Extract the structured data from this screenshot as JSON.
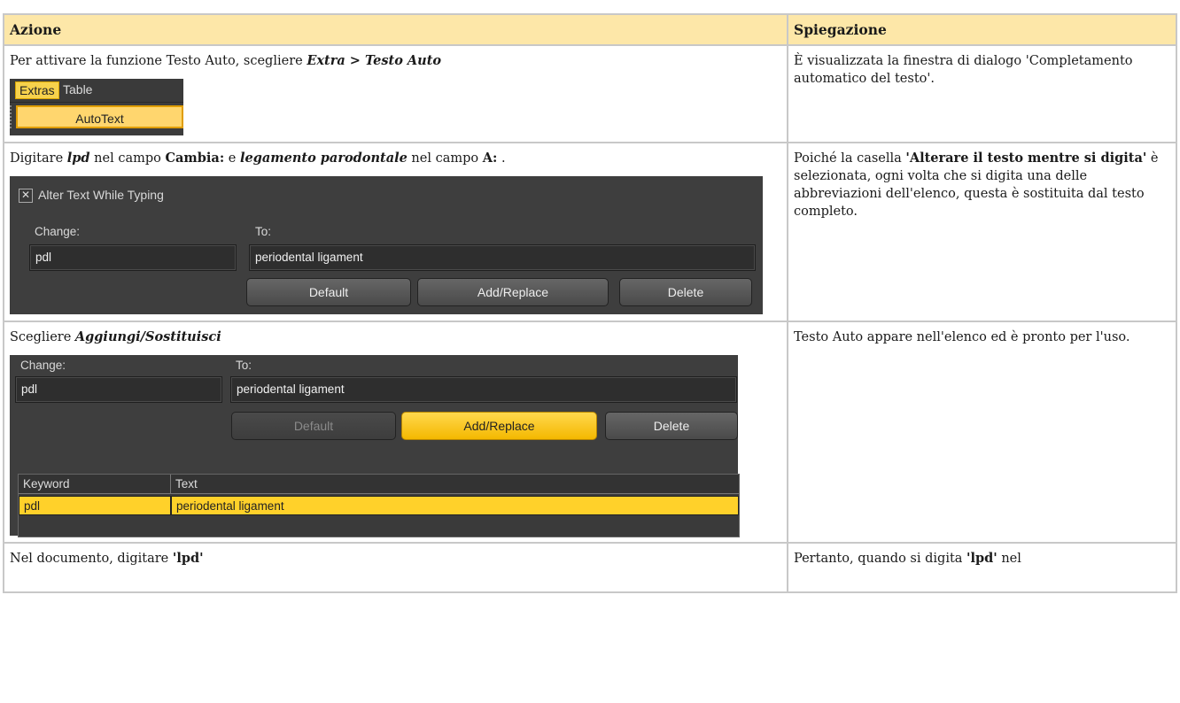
{
  "table": {
    "header_col1": "Azione",
    "header_col2": "Spiegazione"
  },
  "row1": {
    "text_pre": "Per attivare la funzione Testo Auto, scegliere ",
    "text_menu": "Extra > Testo Auto",
    "explain": "È visualizzata la finestra di dialogo 'Completamento automatico del testo'.",
    "menu": {
      "extras": "Extras",
      "table": "Table",
      "item": "AutoText"
    }
  },
  "row2": {
    "p1": "Digitare ",
    "p2": "lpd",
    "p3": " nel campo ",
    "p4": "Cambia:",
    "p5": " e ",
    "p6": "legamento parodontale",
    "p7": " nel campo ",
    "p8": "A:",
    "p9": " .",
    "explain_pre": "Poiché la casella ",
    "explain_bold": "'Alterare il testo mentre si digita'",
    "explain_post": " è selezionata, ogni volta che si digita una delle abbreviazioni dell'elenco, questa è sostituita dal testo completo.",
    "dialog": {
      "checkbox_label": "Alter Text While Typing",
      "checkbox_mark": "✕",
      "change_label": "Change:",
      "to_label": "To:",
      "change_value": "pdl",
      "to_value": "periodental ligament",
      "btn_default": "Default",
      "btn_add": "Add/Replace",
      "btn_delete": "Delete"
    }
  },
  "row3": {
    "text_pre": "Scegliere ",
    "text_bold": "Aggiungi/Sostituisci",
    "explain": "Testo Auto appare nell'elenco ed è pronto per l'uso.",
    "dialog": {
      "change_label": "Change:",
      "to_label": "To:",
      "change_value": "pdl",
      "to_value": "periodental ligament",
      "btn_default": "Default",
      "btn_add": "Add/Replace",
      "btn_delete": "Delete",
      "col_keyword": "Keyword",
      "col_text": "Text",
      "row_keyword": "pdl",
      "row_text": "periodental ligament"
    }
  },
  "row4": {
    "text_pre": "Nel documento, digitare ",
    "text_bold": "'lpd'",
    "explain_pre": "Pertanto, quando si digita ",
    "explain_bold": "'lpd'",
    "explain_post": " nel"
  }
}
